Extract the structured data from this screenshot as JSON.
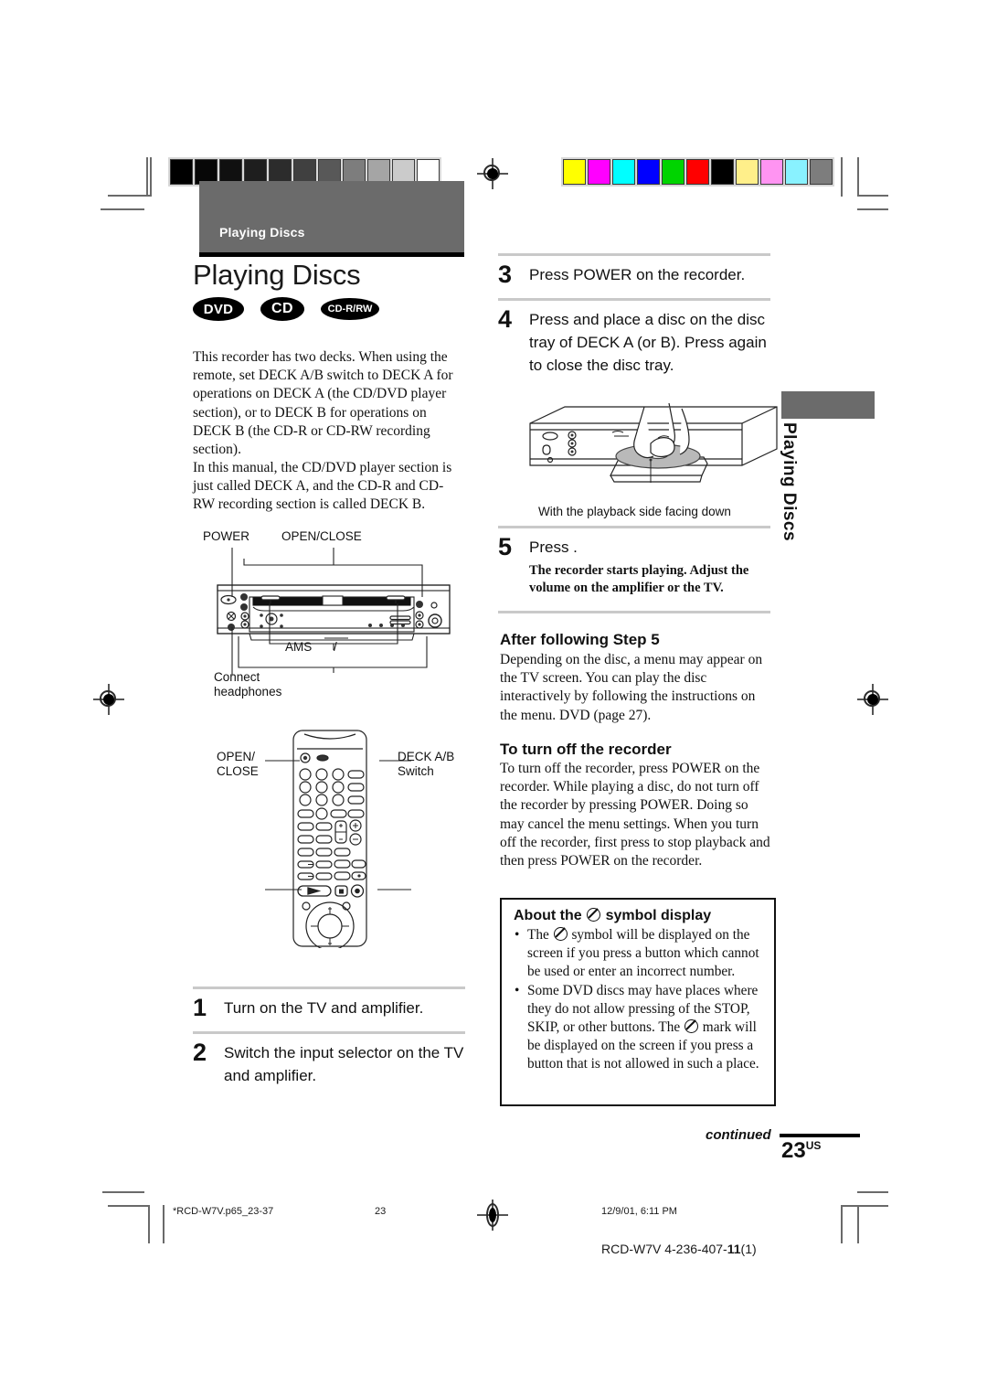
{
  "header": {
    "tab_label": "Playing Discs",
    "chapter_title": "Playing Discs",
    "badges": [
      {
        "id": "dvd",
        "label": "DVD"
      },
      {
        "id": "cd",
        "label": "CD"
      },
      {
        "id": "cdrw",
        "label": "CD-R/RW"
      }
    ]
  },
  "side_tab": {
    "label": "Playing Discs"
  },
  "intro": {
    "paragraph_1": "This recorder has two decks. When using the remote, set DECK A/B switch to DECK A for operations on DECK A (the CD/DVD player section), or to DECK B for operations on DECK B (the CD-R or CD-RW recording section).",
    "paragraph_2": "In this manual, the CD/DVD player section is just called DECK A, and the CD-R and CD-RW recording section is called DECK B."
  },
  "recorder_diagram": {
    "label_power": "POWER",
    "label_open_close": "OPEN/CLOSE",
    "label_ams": "AMS",
    "label_ams_slash": "/",
    "label_connect_headphones": "Connect\nheadphones"
  },
  "remote_diagram": {
    "label_open_close": "OPEN/\nCLOSE",
    "label_deck_ab": "DECK A/B\nSwitch"
  },
  "steps": [
    {
      "num": "1",
      "text": "Turn on the TV and amplifier."
    },
    {
      "num": "2",
      "text": "Switch the input selector on the TV and amplifier."
    },
    {
      "num": "3",
      "text": "Press POWER on the recorder."
    },
    {
      "num": "4",
      "text": "Press   and place a disc on the disc tray of DECK A (or B). Press   again to close the disc tray."
    },
    {
      "num": "5",
      "text": "Press   .",
      "sub": "The recorder starts playing. Adjust the volume on the amplifier or the TV."
    }
  ],
  "tray_figure": {
    "caption": "With the playback side facing down"
  },
  "after_step": {
    "heading": "After following Step 5",
    "body": "Depending on the disc, a menu may appear on the TV screen. You can play the disc interactively by following the instructions on the menu. DVD (page 27)."
  },
  "turn_off": {
    "heading": "To turn off the recorder",
    "body": "To turn off the recorder, press POWER on the recorder. While playing a disc, do not turn off the recorder by pressing POWER. Doing so may cancel the menu settings. When you turn off the recorder, first press    to stop playback and then press POWER on the recorder."
  },
  "note_box": {
    "heading_before": "About the",
    "heading_after": "symbol display",
    "bullets": [
      {
        "before": "The",
        "after": "symbol will be displayed on the screen if you press a button which cannot be used or enter an incorrect number."
      },
      {
        "before": "Some DVD discs may have places where they do not allow pressing of the STOP, SKIP, or other buttons. The",
        "after": "mark will be displayed on the screen if you press a button  that is not allowed in such a place."
      }
    ]
  },
  "footer": {
    "continued": "continued",
    "page_number": "23",
    "page_suffix": "US",
    "file_name": "*RCD-W7V.p65_23-37",
    "sheet_page": "23",
    "timestamp": "12/9/01, 6:11 PM",
    "doc_code_prefix": "RCD-W7V 4-236-407-",
    "doc_code_bold": "11",
    "doc_code_suffix": "(1)"
  },
  "calibration": {
    "gray_swatches": [
      "#000000",
      "#070707",
      "#101010",
      "#1e1e1e",
      "#2c2c2c",
      "#404040",
      "#585858",
      "#7d7d7d",
      "#a5a5a5",
      "#cbcbcb",
      "#ffffff"
    ],
    "color_swatches": [
      "#ffff00",
      "#ff00ff",
      "#00ffff",
      "#0000ff",
      "#00d400",
      "#ff0000",
      "#000000",
      "#ffef8a",
      "#ff94f2",
      "#89f2ff",
      "#7d7d7d"
    ]
  },
  "colors": {
    "tab_gray": "#6b6b6b",
    "rule_gray": "#c9c9c9",
    "ink": "#111111"
  }
}
